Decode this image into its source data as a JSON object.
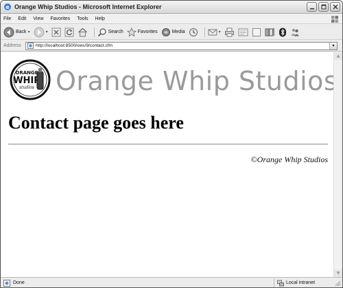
{
  "window": {
    "title": "Orange Whip Studios - Microsoft Internet Explorer"
  },
  "menu": [
    "File",
    "Edit",
    "View",
    "Favorites",
    "Tools",
    "Help"
  ],
  "toolbar": {
    "back_label": "Back",
    "search_label": "Search",
    "favorites_label": "Favorites",
    "media_label": "Media"
  },
  "address": {
    "label": "Address",
    "url": "http://localhost:8500/ows/9/contact.cfm"
  },
  "page": {
    "logo_text_top": "ORANGE",
    "logo_text_main": "WHIP",
    "logo_text_bottom": "studios",
    "site_title": "Orange Whip Studios",
    "heading": "Contact page goes here",
    "footer": "©Orange Whip Studios"
  },
  "status": {
    "text": "Done",
    "zone": "Local intranet"
  },
  "colors": {
    "site_title": "#9a9a9a",
    "heading": "#000000"
  }
}
